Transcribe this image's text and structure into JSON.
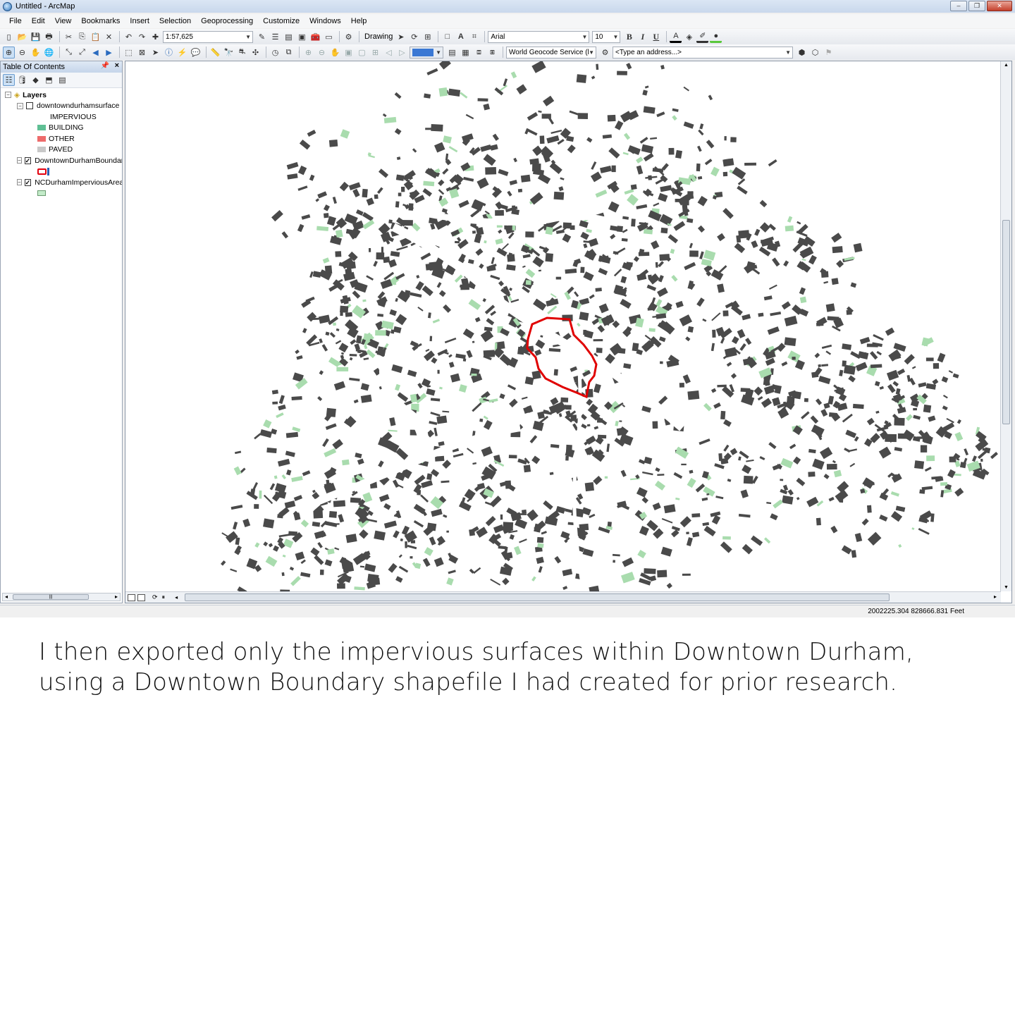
{
  "window": {
    "title": "Untitled - ArcMap",
    "controls": [
      "–",
      "❐",
      "✕"
    ]
  },
  "menu": [
    "File",
    "Edit",
    "View",
    "Bookmarks",
    "Insert",
    "Selection",
    "Geoprocessing",
    "Customize",
    "Windows",
    "Help"
  ],
  "toolbar": {
    "scale": "1:57,625",
    "drawing_label": "Drawing",
    "font_name": "Arial",
    "font_size": "10",
    "bold": "B",
    "italic": "I",
    "underline": "U",
    "geocode_service": "World Geocode Service (l",
    "address_placeholder": "<Type an address...>"
  },
  "toc": {
    "title": "Table Of Contents",
    "root": "Layers",
    "layers": [
      {
        "name": "downtowndurhamsurface",
        "checked": false,
        "field": "IMPERVIOUS",
        "classes": [
          {
            "label": "BUILDING",
            "color": "#5fbf94"
          },
          {
            "label": "OTHER",
            "color": "#ee6b6b"
          },
          {
            "label": "PAVED",
            "color": "#c8c8c8"
          }
        ]
      },
      {
        "name": "DowntownDurhamBoundary",
        "checked": true,
        "swatch_color": "#e3000f"
      },
      {
        "name": "NCDurhamImperviousArea",
        "checked": true,
        "swatch_color": "#c3ebc9"
      }
    ]
  },
  "map": {
    "boundary_color": "#e00000",
    "surface_color": "#4a4a4a",
    "green_color": "#a9dcae"
  },
  "status": {
    "coordinates": "2002225.304  828666.831 Feet"
  },
  "caption": "I then exported only the impervious surfaces within Downtown Durham, using a Downtown Boundary shapefile I had created for prior research."
}
